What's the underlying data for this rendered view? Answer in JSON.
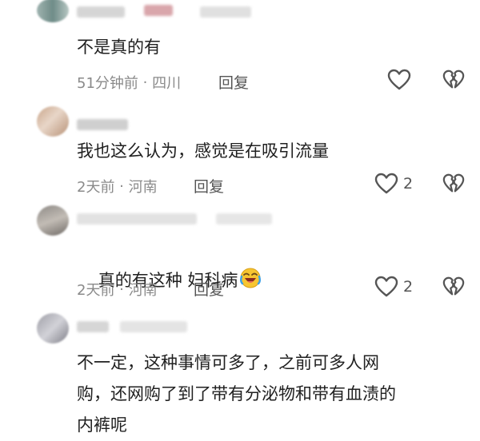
{
  "comments": [
    {
      "text": "不是真的有",
      "time": "51分钟前",
      "location": "四川",
      "reply": "回复",
      "likes": "",
      "liked": false
    },
    {
      "text": "我也这么认为，感觉是在吸引流量",
      "time": "2天前",
      "location": "河南",
      "reply": "回复",
      "likes": "2",
      "liked": false
    },
    {
      "text": "真的有这种 妇科病",
      "time": "2天前",
      "location": "河南",
      "reply": "回复",
      "likes": "2",
      "liked": false,
      "emoji": "laughing-crying-face-icon"
    },
    {
      "text": "不一定，这种事情可多了，之前可多人网\n购，还网购了到了带有分泌物和带有血渍的\n内裤呢",
      "time": "",
      "location": "",
      "reply": "",
      "likes": ""
    }
  ],
  "separator": " · ",
  "icons": {
    "like": "heart-outline-icon",
    "dislike": "broken-heart-icon"
  },
  "colors": {
    "text": "#202020",
    "meta": "#8a8a8a",
    "icon": "#555555"
  }
}
